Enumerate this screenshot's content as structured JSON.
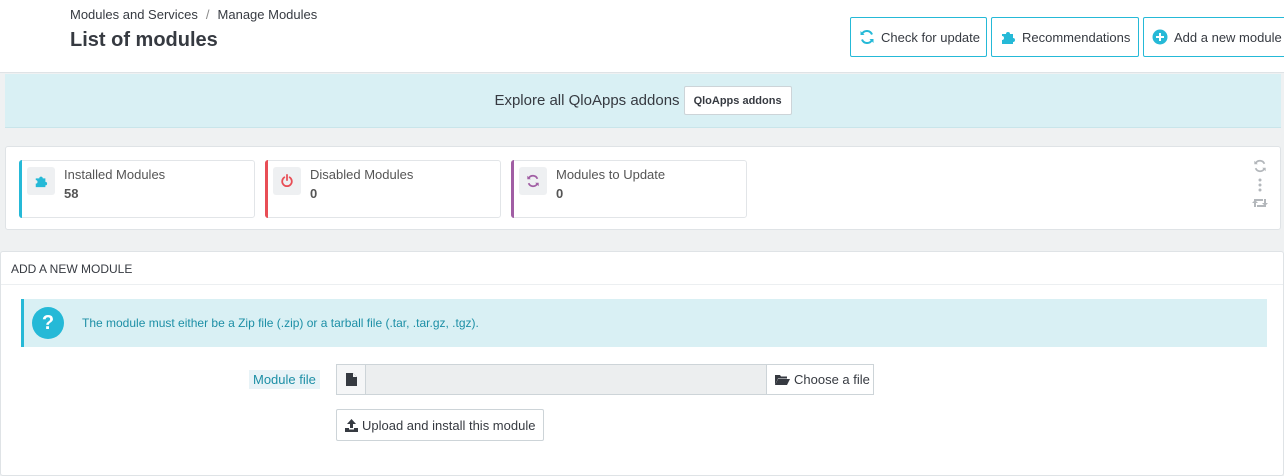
{
  "breadcrumb": {
    "parent": "Modules and Services",
    "separator": "/",
    "current": "Manage Modules"
  },
  "page_title": "List of modules",
  "toolbar": {
    "check_update_label": "Check for update",
    "recommendations_label": "Recommendations",
    "add_module_label": "Add a new module"
  },
  "addons_banner": {
    "text": "Explore all QloApps addons",
    "button_label": "QloApps addons"
  },
  "kpis": [
    {
      "label": "Installed Modules",
      "value": "58",
      "color": "#25b9d7",
      "icon": "puzzle-icon"
    },
    {
      "label": "Disabled Modules",
      "value": "0",
      "color": "#e84e56",
      "icon": "power-icon"
    },
    {
      "label": "Modules to Update",
      "value": "0",
      "color": "#a15ea4",
      "icon": "refresh-icon"
    }
  ],
  "upload_panel": {
    "heading": "Add a new module",
    "info_text": "The module must either be a Zip file (.zip) or a tarball file (.tar, .tar.gz, .tgz).",
    "field_label": "Module file",
    "file_value": "",
    "choose_label": "Choose a file",
    "upload_label": "Upload and install this module"
  },
  "colors": {
    "accent": "#25b9d7",
    "info_bg": "#d9f0f4",
    "danger": "#e84e56",
    "purple": "#a15ea4"
  }
}
